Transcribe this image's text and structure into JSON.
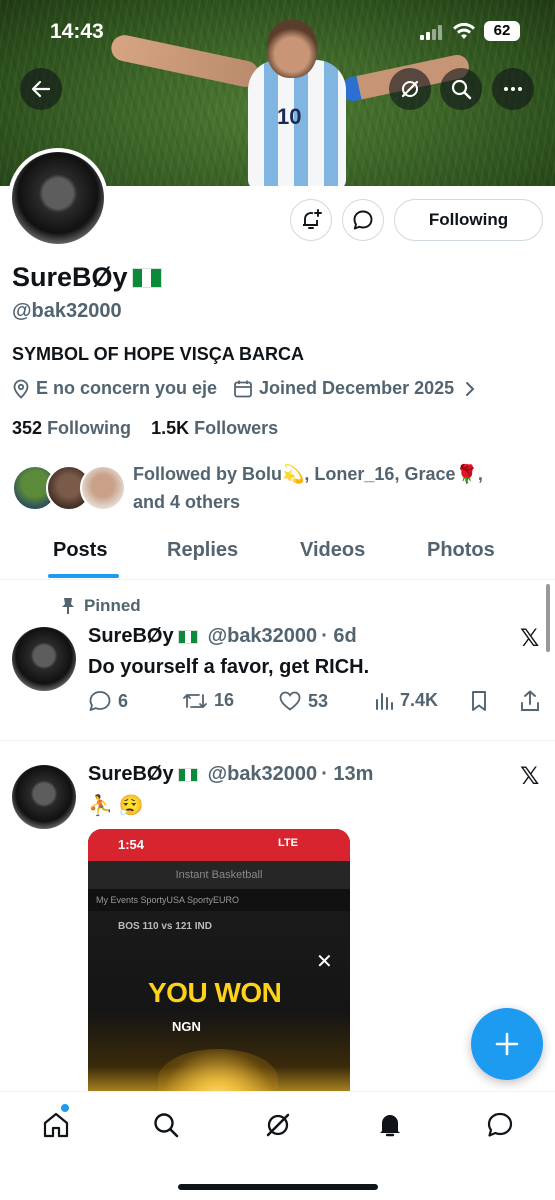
{
  "status_bar": {
    "time": "14:43",
    "battery": "62"
  },
  "banner": {
    "jersey_number": "10"
  },
  "profile": {
    "name": "SureBØy",
    "handle": "@bak32000",
    "bio": "SYMBOL OF HOPE VISÇA BARCA",
    "location": "E no concern you eje",
    "joined": "Joined December 2025",
    "following_count": "352",
    "following_label": "Following",
    "followers_count": "1.5K",
    "followers_label": "Followers",
    "followed_by_line1": "Followed by Bolu💫, Loner_16, Grace🌹,",
    "followed_by_line2": "and 4 others",
    "follow_button": "Following"
  },
  "tabs": [
    {
      "label": "Posts",
      "active": true
    },
    {
      "label": "Replies",
      "active": false
    },
    {
      "label": "Videos",
      "active": false
    },
    {
      "label": "Photos",
      "active": false
    }
  ],
  "posts": [
    {
      "pinned_label": "Pinned",
      "name": "SureBØy",
      "handle": "@bak32000",
      "time": "· 6d",
      "text": "Do yourself a favor, get RICH.",
      "replies": "6",
      "reposts": "16",
      "likes": "53",
      "views": "7.4K"
    },
    {
      "name": "SureBØy",
      "handle": "@bak32000",
      "time": "· 13m",
      "text": "⛹️ 😮‍💨",
      "media": {
        "time": "1:54",
        "network": "LTE",
        "game_title": "Instant Basketball",
        "tabs": "My Events    SportyUSA    SportyEURO",
        "score_line": "BOS 110 vs 121 IND",
        "headline": "YOU WON",
        "amount_prefix": "NGN",
        "close": "✕"
      }
    }
  ],
  "icons": {
    "back": "back-arrow-icon",
    "grok": "grok-icon",
    "search": "search-icon",
    "more": "more-icon",
    "notify": "notification-bell-plus-icon",
    "message": "message-icon",
    "location": "location-pin-icon",
    "calendar": "calendar-icon",
    "pin": "pin-icon",
    "x": "𝕏"
  },
  "colors": {
    "accent": "#1d9bf0",
    "text": "#0f1419",
    "muted": "#536471"
  }
}
